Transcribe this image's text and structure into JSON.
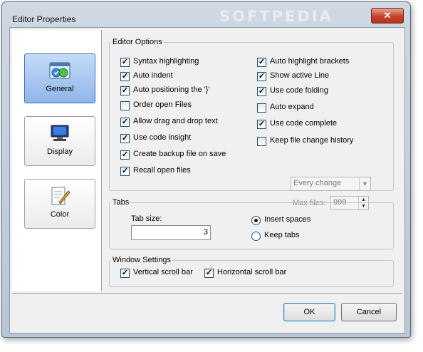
{
  "window": {
    "title": "Editor Properties",
    "watermark": "SOFTPEDIA",
    "close_glyph": "✕"
  },
  "nav": [
    {
      "label": "General",
      "icon": "general-settings-icon",
      "active": true
    },
    {
      "label": "Display",
      "icon": "monitor-icon",
      "active": false
    },
    {
      "label": "Color",
      "icon": "color-edit-icon",
      "active": false
    }
  ],
  "editor_options": {
    "legend": "Editor Options",
    "left": [
      {
        "label": "Syntax highlighting",
        "checked": true
      },
      {
        "label": "Auto indent",
        "checked": true
      },
      {
        "label": "Auto positioning the '}'",
        "checked": true
      },
      {
        "label": "Order open Files",
        "checked": false
      },
      {
        "label": "Allow drag and drop text",
        "checked": true
      },
      {
        "label": "Use code insight",
        "checked": true
      },
      {
        "label": "Create backup file on save",
        "checked": true
      },
      {
        "label": "Recall open files",
        "checked": true
      }
    ],
    "right": [
      {
        "label": "Auto highlight brackets",
        "checked": true
      },
      {
        "label": "Show active Line",
        "checked": true
      },
      {
        "label": "Use code folding",
        "checked": true
      },
      {
        "label": "Auto expand",
        "checked": false
      },
      {
        "label": "Use code complete",
        "checked": true
      },
      {
        "label": "Keep file change history",
        "checked": false
      }
    ],
    "history_combo": "Every change",
    "max_files_label": "Max files:",
    "max_files_value": "999"
  },
  "tabs": {
    "legend": "Tabs",
    "tab_size_label": "Tab size:",
    "tab_size_value": "3",
    "insert_spaces": "Insert spaces",
    "keep_tabs": "Keep tabs",
    "selected": "insert_spaces"
  },
  "window_settings": {
    "legend": "Window Settings",
    "vertical": "Vertical scroll bar",
    "horizontal": "Horizontal scroll bar"
  },
  "buttons": {
    "ok": "OK",
    "cancel": "Cancel"
  },
  "check_glyph": "✓"
}
